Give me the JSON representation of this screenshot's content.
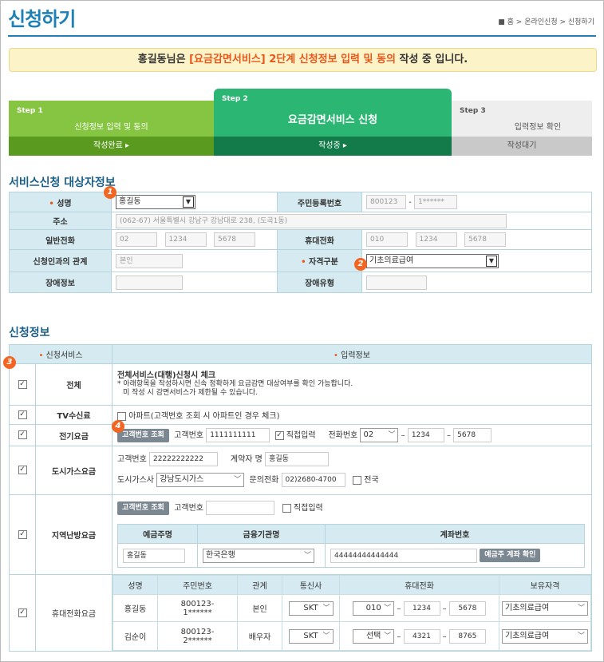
{
  "page": {
    "title": "신청하기",
    "breadcrumb": "■ 홈 > 온라인신청 > 신청하기"
  },
  "notice": {
    "prefix": "홍길동님은 ",
    "highlight": "[요금감면서비스] 2단계 신청정보 입력 및 동의",
    "suffix": " 작성 중 입니다."
  },
  "steps": [
    {
      "no": "Step 1",
      "label": "신청정보 입력 및 동의",
      "status": "작성완료 ▸"
    },
    {
      "no": "Step 2",
      "label": "요금감면서비스 신청",
      "status": "작성중 ▸"
    },
    {
      "no": "Step 3",
      "label": "입력정보 확인",
      "status": "작성대기"
    }
  ],
  "target": {
    "heading": "서비스신청 대상자정보",
    "name_label": "• 성명",
    "name_value": "홍길동",
    "rrn_label": "주민등록번호",
    "rrn_front": "800123",
    "rrn_dash": "-",
    "rrn_back": "1******",
    "addr_label": "주소",
    "addr_value": "(062-67) 서울특별시 강남구 강남대로 238, (도곡1동)",
    "phone_label": "일반전화",
    "phone": [
      "02",
      "1234",
      "5678"
    ],
    "mobile_label": "휴대전화",
    "mobile": [
      "010",
      "1234",
      "5678"
    ],
    "rel_label": "신청인과의 관계",
    "rel_value": "본인",
    "qual_label": "• 자격구분",
    "qual_value": "기초의료급여",
    "dis_info_label": "장애정보",
    "dis_type_label": "장애유형"
  },
  "apply": {
    "heading": "신청정보",
    "col_service": "• 신청서비스",
    "col_input": "• 입력정보",
    "all": {
      "label": "전체",
      "title": "전체서비스(대행)신청시 체크",
      "desc1": "* 아래항목을 작성하시면 신속 정확하게 요금감면 대상여부를 확인 가능합니다.",
      "desc2": "미 작성 시 감면서비스가 제한될 수 있습니다."
    },
    "tv": {
      "label": "TV수신료",
      "apt": "아파트(고객번호 조회 시 아파트인 경우 체크)"
    },
    "elec": {
      "label": "전기요금",
      "btn": "고객번호 조회",
      "cust_label": "고객번호",
      "cust_value": "1111111111",
      "direct": "직접입력",
      "tel_label": "전화번호",
      "tel": [
        "02",
        "1234",
        "5678"
      ]
    },
    "gas": {
      "label": "도시가스요금",
      "cust_label": "고객번호",
      "cust_value": "22222222222",
      "owner_label": "계약자 명",
      "owner_value": "홍길동",
      "company_label": "도시가스사",
      "company_value": "강남도시가스",
      "inq_label": "문의전화",
      "inq_value": "02)2680-4700",
      "nation": "전국"
    },
    "heat": {
      "label": "지역난방요금",
      "btn": "고객번호 조회",
      "cust_label": "고객번호",
      "direct": "직접입력",
      "h_holder": "예금주명",
      "h_bank": "금융기관명",
      "h_acct": "계좌번호",
      "holder": "홍길동",
      "bank": "한국은행",
      "acct": "44444444444444",
      "confirm": "예금주 계좌 확인"
    },
    "mobile": {
      "label": "휴대전화요금",
      "headers": [
        "성명",
        "주민번호",
        "관계",
        "통신사",
        "휴대전화",
        "보유자격"
      ],
      "rows": [
        {
          "name": "홍길동",
          "rrn1": "800123-",
          "rrn2": "1******",
          "rel": "본인",
          "carrier": "SKT",
          "p1": "010",
          "p2": "1234",
          "p3": "5678",
          "qual": "기초의료급여"
        },
        {
          "name": "김순이",
          "rrn1": "800123-",
          "rrn2": "2******",
          "rel": "배우자",
          "carrier": "SKT",
          "p1": "선택",
          "p2": "4321",
          "p3": "8765",
          "qual": "기초의료급여"
        }
      ]
    }
  },
  "badges": [
    "1",
    "2",
    "3",
    "4"
  ]
}
